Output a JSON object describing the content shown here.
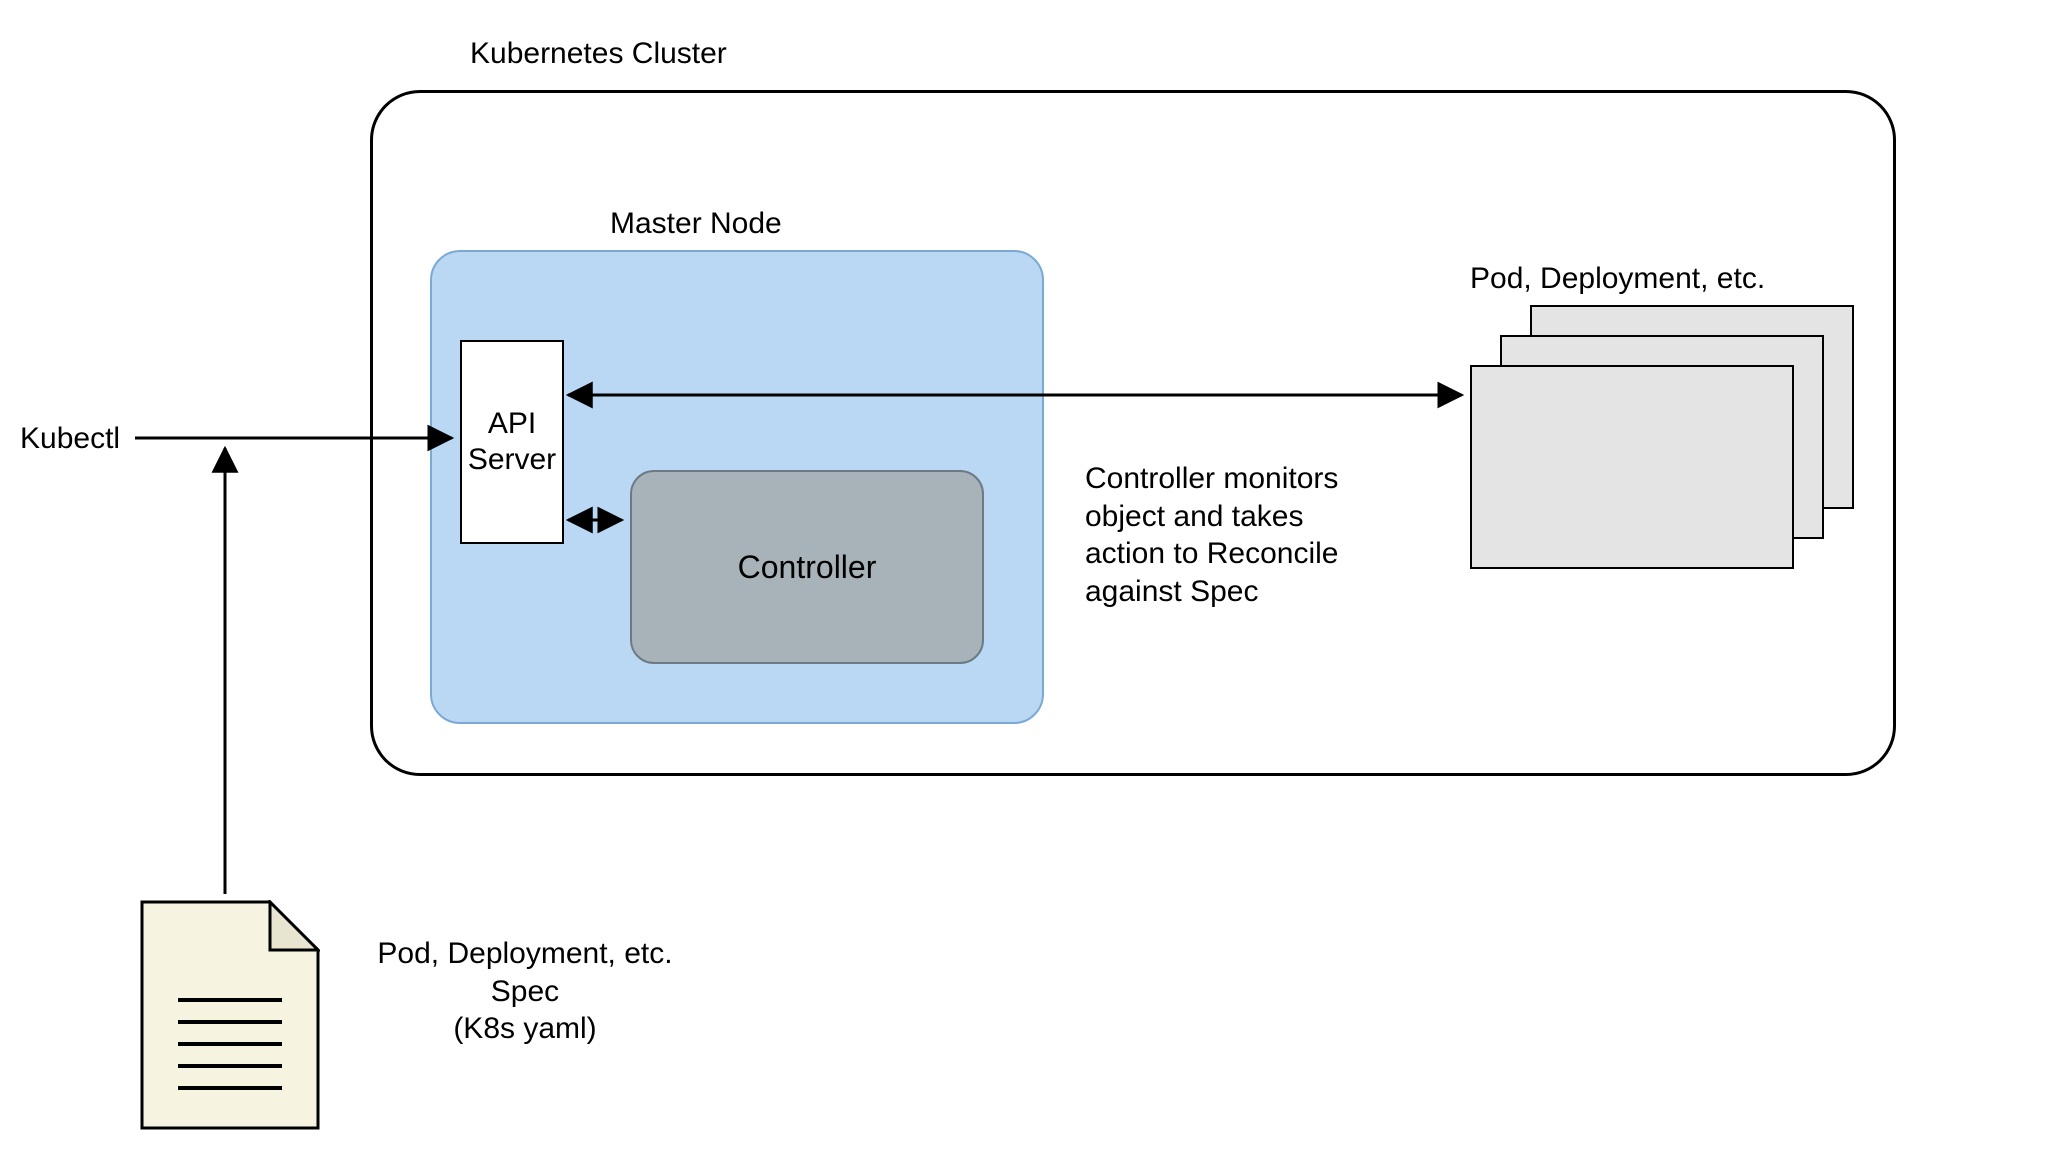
{
  "title": "Kubernetes Cluster",
  "masterNodeLabel": "Master Node",
  "kubectlLabel": "Kubectl",
  "apiServerLabel": "API\nServer",
  "controllerLabel": "Controller",
  "resourcesLabel": "Pod, Deployment, etc.",
  "controllerDescription": "Controller monitors\nobject and takes\naction to Reconcile\nagainst Spec",
  "specLabel": "Pod, Deployment, etc.\nSpec\n(K8s yaml)",
  "colors": {
    "masterFill": "#bad8f4",
    "masterStroke": "#7aa9d6",
    "controllerFill": "#a7b2b9",
    "controllerStroke": "#6b7a85",
    "cardFill": "#e4e4e4",
    "docFill": "#f6f3e0"
  }
}
